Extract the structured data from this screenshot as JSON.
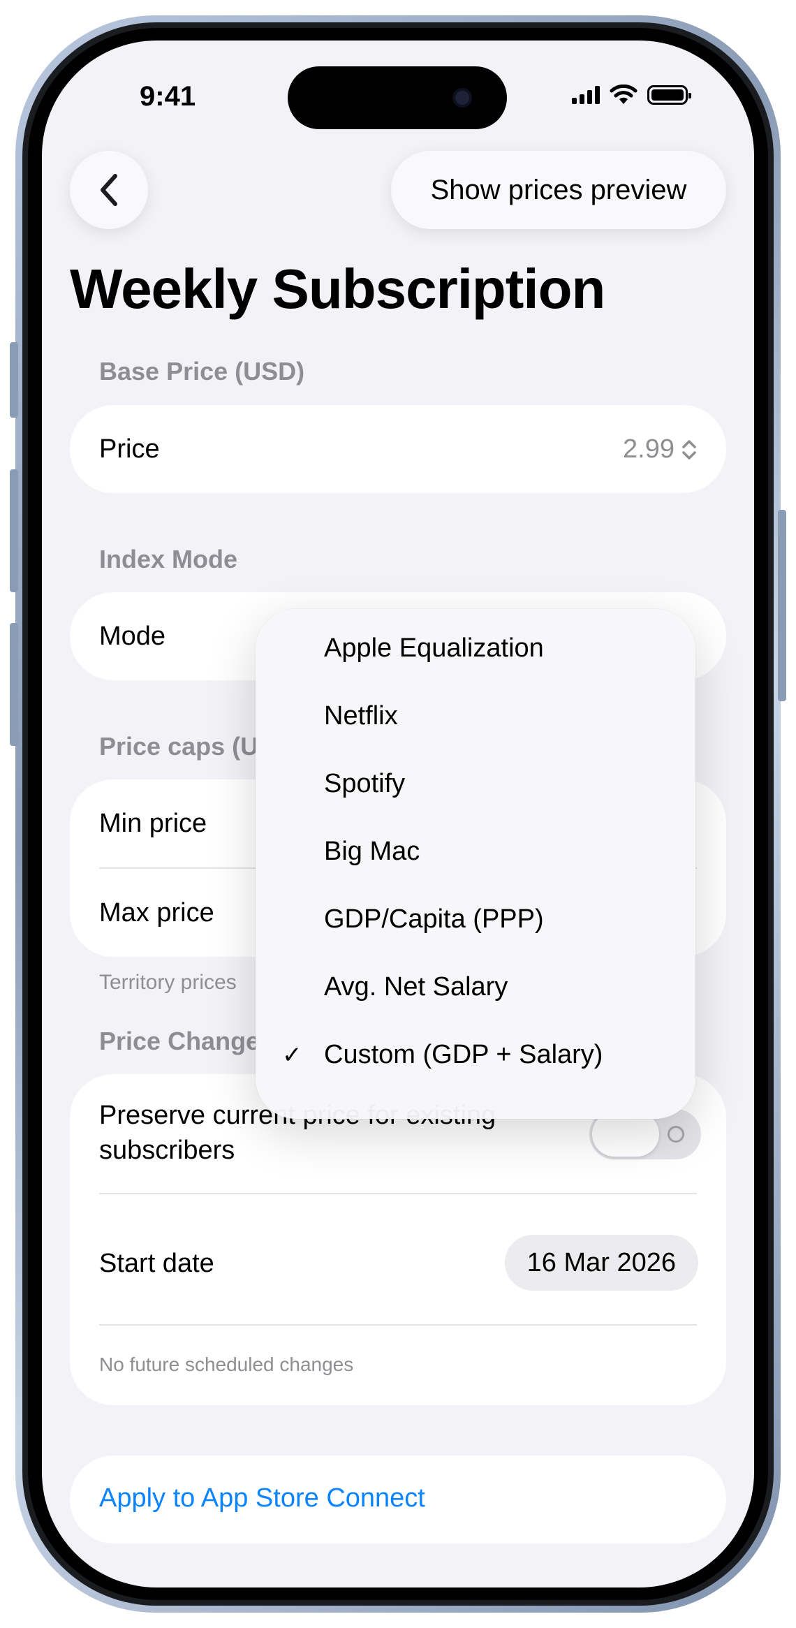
{
  "status_bar": {
    "time": "9:41"
  },
  "header": {
    "back_label": "‹",
    "preview_button": "Show prices preview",
    "title": "Weekly Subscription"
  },
  "base_price": {
    "section_label": "Base Price (USD)",
    "price_label": "Price",
    "price_value": "2.99"
  },
  "index_mode": {
    "section_label": "Index Mode",
    "mode_label": "Mode"
  },
  "price_caps": {
    "section_label": "Price caps (U",
    "min_label": "Min price",
    "max_label": "Max price",
    "footnote": "Territory prices"
  },
  "price_change": {
    "section_label": "Price Change",
    "preserve_label": "Preserve current price for existing subscribers",
    "preserve_on": false,
    "start_date_label": "Start date",
    "start_date_value": "16 Mar 2026",
    "no_changes": "No future scheduled changes"
  },
  "apply": {
    "label": "Apply to App Store Connect"
  },
  "mode_menu": {
    "items": [
      {
        "label": "Apple Equalization",
        "checked": false
      },
      {
        "label": "Netflix",
        "checked": false
      },
      {
        "label": "Spotify",
        "checked": false
      },
      {
        "label": "Big Mac",
        "checked": false
      },
      {
        "label": "GDP/Capita (PPP)",
        "checked": false
      },
      {
        "label": "Avg. Net Salary",
        "checked": false
      },
      {
        "label": "Custom (GDP + Salary)",
        "checked": true
      }
    ],
    "check_glyph": "✓"
  },
  "colors": {
    "accent": "#0a84ff",
    "background": "#f2f2f7",
    "secondary_text": "#8e8e93"
  }
}
